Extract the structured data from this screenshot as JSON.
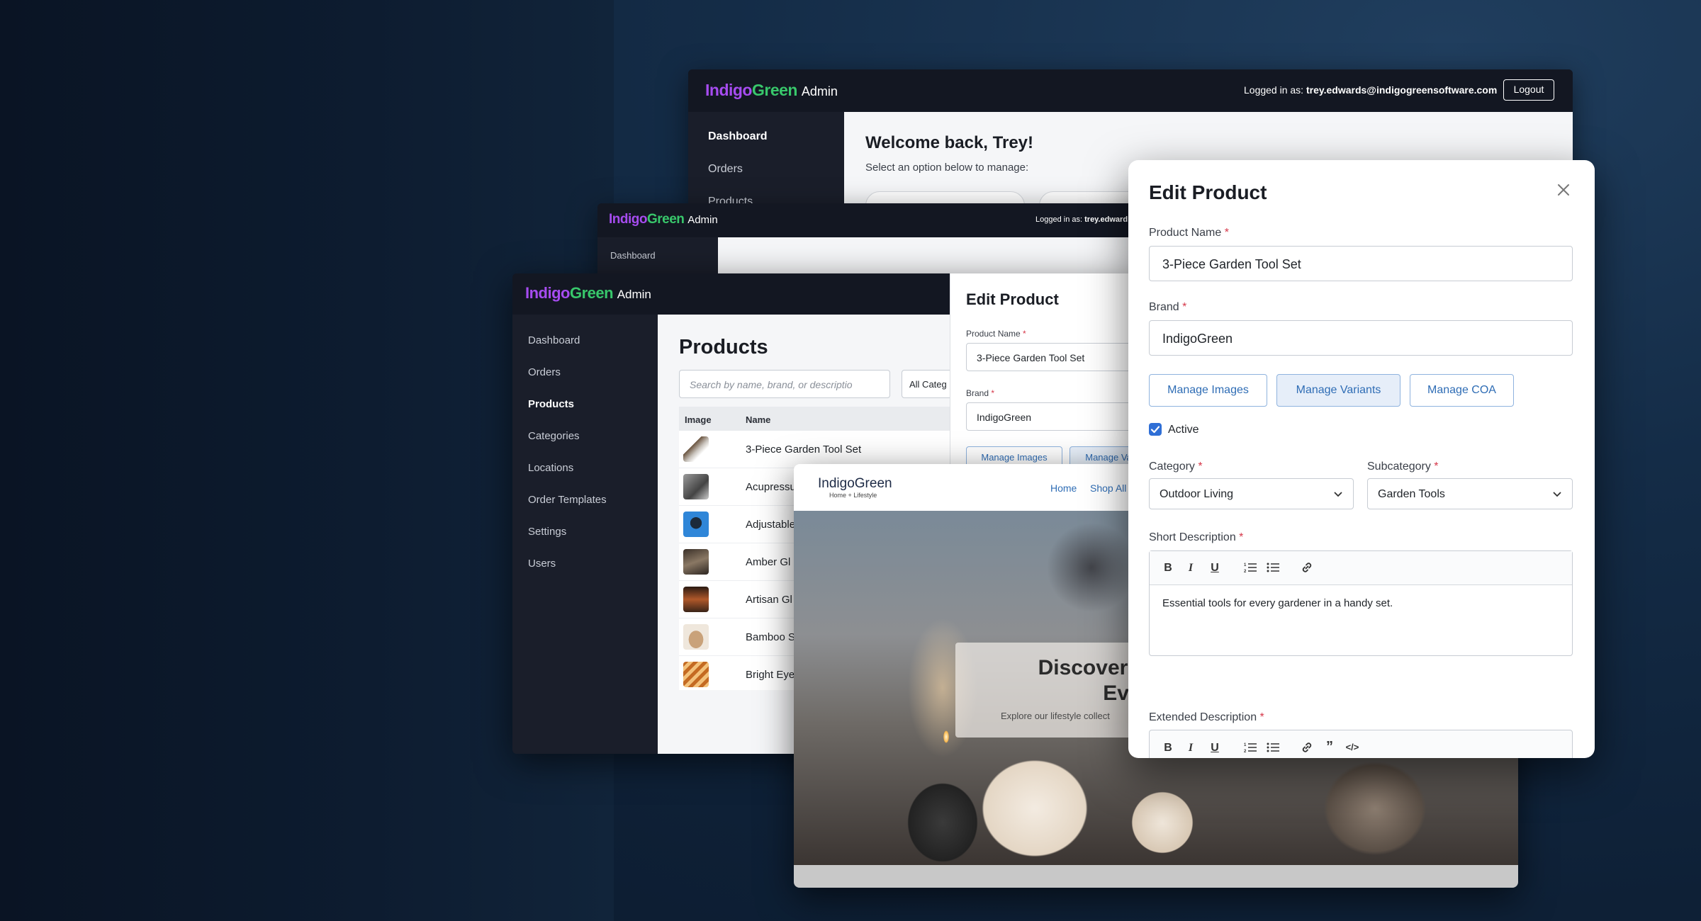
{
  "brand": {
    "part1": "Indigo",
    "part2": "Green",
    "part3": "Admin"
  },
  "back_window": {
    "logged_in_prefix": "Logged in as:",
    "user_email": "trey.edwards@indigogreensoftware.com",
    "logout_label": "Logout",
    "nav": [
      "Dashboard",
      "Orders",
      "Products"
    ],
    "welcome_title": "Welcome back, Trey!",
    "welcome_subtitle": "Select an option below to manage:"
  },
  "middle_window": {
    "logged_in_prefix": "Logged in as:",
    "user_email_partial": "trey.edward",
    "nav_item": "Dashboard"
  },
  "products_window": {
    "nav": [
      "Dashboard",
      "Orders",
      "Products",
      "Categories",
      "Locations",
      "Order Templates",
      "Settings",
      "Users"
    ],
    "active_nav": "Products",
    "page_title": "Products",
    "search_placeholder": "Search by name, brand, or descriptio",
    "category_filter": "All Categ",
    "columns": [
      "Image",
      "Name"
    ],
    "rows": [
      "3-Piece Garden Tool Set",
      "Acupressu",
      "Adjustable",
      "Amber Gl",
      "Artisan Gl",
      "Bamboo S",
      "Bright Eye"
    ],
    "edit_panel": {
      "title": "Edit Product",
      "product_name_label": "Product Name",
      "product_name_value": "3-Piece Garden Tool Set",
      "brand_label": "Brand",
      "brand_value": "IndigoGreen",
      "btn_images": "Manage Images",
      "btn_variants": "Manage Va"
    }
  },
  "storefront": {
    "logo_main": "IndigoGreen",
    "logo_sub": "Home + Lifestyle",
    "nav": [
      "Home",
      "Shop All"
    ],
    "hero_title_line1": "Discover Be",
    "hero_title_line2": "Every",
    "hero_subtitle": "Explore our lifestyle collect"
  },
  "edit_modal": {
    "title": "Edit Product",
    "product_name_label": "Product Name",
    "product_name_value": "3-Piece Garden Tool Set",
    "brand_label": "Brand",
    "brand_value": "IndigoGreen",
    "btn_images": "Manage Images",
    "btn_variants": "Manage Variants",
    "btn_coa": "Manage COA",
    "active_label": "Active",
    "active_checked": true,
    "category_label": "Category",
    "category_value": "Outdoor Living",
    "subcategory_label": "Subcategory",
    "subcategory_value": "Garden Tools",
    "short_desc_label": "Short Description",
    "short_desc_value": "Essential tools for every gardener in a handy set.",
    "extended_desc_label": "Extended Description",
    "required_mark": "*"
  },
  "colors": {
    "brand_purple": "#a64cf0",
    "brand_green": "#38c76b",
    "accent_blue": "#2f6db5",
    "required_red": "#d6384a"
  }
}
